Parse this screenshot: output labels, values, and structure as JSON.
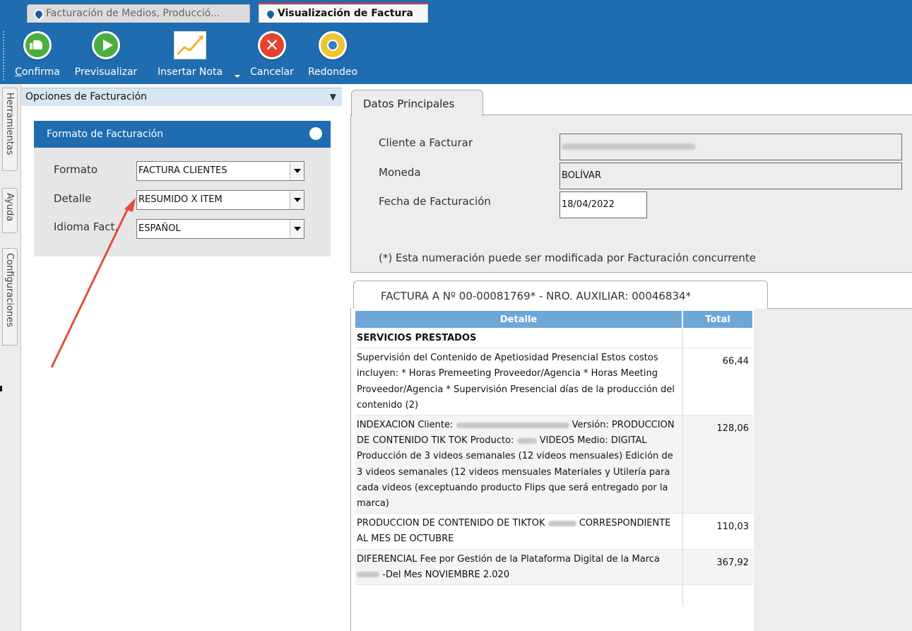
{
  "tabs": [
    {
      "label": "Facturación de Medios, Producció..."
    },
    {
      "label": "Visualización de Factura"
    }
  ],
  "toolbar": {
    "confirma": "Confirma",
    "previsualizar": "Previsualizar",
    "insertar_nota": "Insertar Nota",
    "cancelar": "Cancelar",
    "redondeo": "Redondeo"
  },
  "side_tabs": [
    "Herramientas",
    "Ayuda",
    "Configuraciones"
  ],
  "options_panel": {
    "title": "Opciones de Facturación",
    "format_group": {
      "title": "Formato de Facturación",
      "rows": [
        {
          "label": "Formato",
          "value": "FACTURA CLIENTES"
        },
        {
          "label": "Detalle",
          "value": "RESUMIDO X ITEM"
        },
        {
          "label": "Idioma Fact.",
          "value": "ESPAÑOL"
        }
      ]
    }
  },
  "datos_principales": {
    "tab_label": "Datos Principales",
    "cliente_label": "Cliente a Facturar",
    "moneda_label": "Moneda",
    "moneda_value": "BOLÍVAR",
    "fecha_label": "Fecha de Facturación",
    "fecha_value": "18/04/2022",
    "note": "(*) Esta numeración puede ser modificada por Facturación concurrente"
  },
  "invoice": {
    "tab_label": "FACTURA A Nº 00-00081769* - NRO. AUXILIAR: 00046834*",
    "headers": {
      "detail": "Detalle",
      "total": "Total"
    },
    "section_title": "SERVICIOS PRESTADOS",
    "rows": [
      {
        "detail": "Supervisión del Contenido de Apetiosidad Presencial Estos costos incluyen: * Horas Premeeting Proveedor/Agencia * Horas Meeting Proveedor/Agencia * Supervisión Presencial días de la producción  del contenido (2)",
        "total": "66,44"
      },
      {
        "detail_a": "INDEXACION Cliente:",
        "detail_b": "Versión: PRODUCCION DE CONTENIDO TIK TOK Producto:",
        "detail_c": "VIDEOS Medio: DIGITAL Producción de 3 videos semanales (12 videos mensuales) Edición de 3 videos semanales (12 videos mensuales Materiales y Utilería para cada videos (exceptuando producto Flips que será entregado por la marca)",
        "total": "128,06"
      },
      {
        "detail_a": "PRODUCCION DE CONTENIDO DE TIKTOK",
        "detail_b": "CORRESPONDIENTE AL MES DE OCTUBRE",
        "total": "110,03"
      },
      {
        "detail_a": "DIFERENCIAL Fee por Gestión de la Plataforma Digital de la Marca",
        "detail_b": "-Del Mes NOVIEMBRE  2.020",
        "total": "367,92"
      }
    ]
  },
  "colors": {
    "ribbon_blue": "#1f6cb0",
    "header_blue": "#6fa6d8",
    "annotation_red": "#e0503a"
  }
}
